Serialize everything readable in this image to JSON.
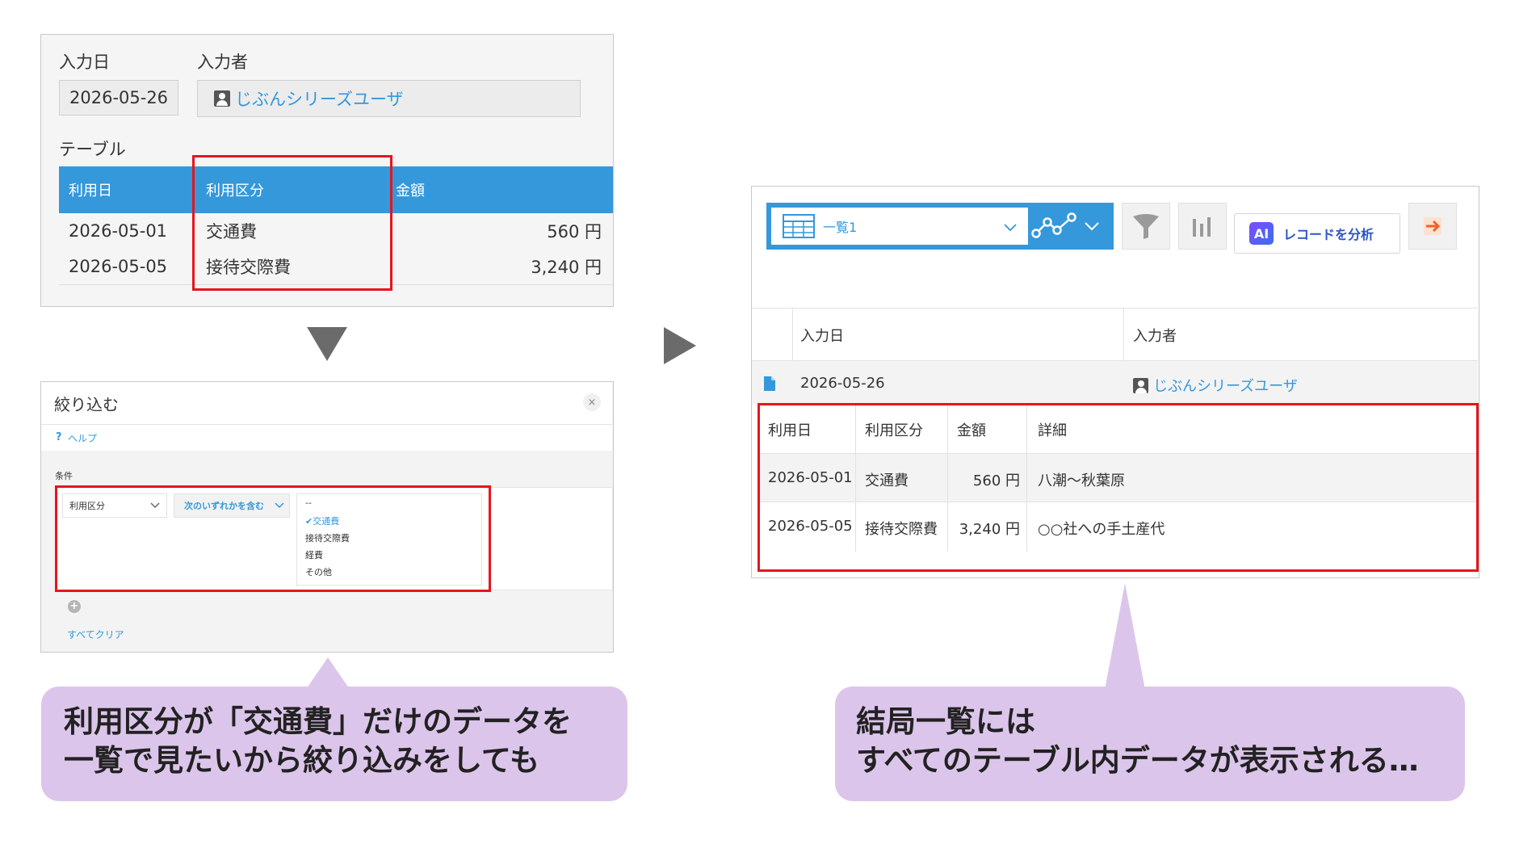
{
  "record": {
    "date_label": "入力日",
    "date_value": "2026-05-26",
    "user_label": "入力者",
    "user_value": "じぶんシリーズユーザ",
    "table_label": "テーブル",
    "columns": [
      "利用日",
      "利用区分",
      "金額"
    ],
    "rows": [
      {
        "date": "2026-05-01",
        "category": "交通費",
        "amount": "560 円"
      },
      {
        "date": "2026-05-05",
        "category": "接待交際費",
        "amount": "3,240 円"
      }
    ]
  },
  "filter": {
    "title": "絞り込む",
    "close": "×",
    "help": "ヘルプ",
    "help_mark": "?",
    "condition_label": "条件",
    "field_select": "利用区分",
    "operator_select": "次のいずれかを含む",
    "options": [
      "--",
      "交通費",
      "接待交際費",
      "経費",
      "その他"
    ],
    "selected_mark": "✔",
    "clear_all": "すべてクリア",
    "add_mark": "+"
  },
  "list": {
    "view_name": "一覧1",
    "analyze_button": "レコードを分析",
    "ai_badge": "AI",
    "headers": [
      "入力日",
      "入力者"
    ],
    "record": {
      "date": "2026-05-26",
      "user": "じぶんシリーズユーザ"
    },
    "sub_headers": [
      "利用日",
      "利用区分",
      "金額",
      "詳細"
    ],
    "sub_rows": [
      {
        "date": "2026-05-01",
        "category": "交通費",
        "amount": "560 円",
        "detail": "八潮～秋葉原"
      },
      {
        "date": "2026-05-05",
        "category": "接待交際費",
        "amount": "3,240 円",
        "detail": "○○社への手土産代"
      }
    ]
  },
  "callouts": {
    "left_line1": "利用区分が「交通費」だけのデータを",
    "left_line2": "一覧で見たいから絞り込みをしても",
    "right_line1": "結局一覧には",
    "right_line2": "すべてのテーブル内データが表示される…"
  },
  "colors": {
    "accent": "#3498db",
    "highlight": "#e8141c",
    "callout": "#dcc5eb",
    "arrow": "#6b6b6b"
  }
}
